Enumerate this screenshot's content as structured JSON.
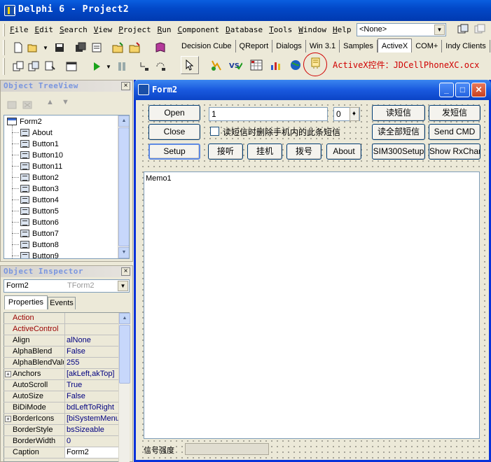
{
  "ide": {
    "title": "Delphi 6 - Project2",
    "menu": [
      "File",
      "Edit",
      "Search",
      "View",
      "Project",
      "Run",
      "Component",
      "Database",
      "Tools",
      "Window",
      "Help"
    ],
    "config_combo": "<None>",
    "palette_tabs": [
      "Decision Cube",
      "QReport",
      "Dialogs",
      "Win 3.1",
      "Samples",
      "ActiveX",
      "COM+",
      "Indy Clients"
    ],
    "active_tab": "ActiveX",
    "activex_note": "ActiveX控件：JDCellPhoneXC.ocx"
  },
  "tree_view": {
    "title": "Object TreeView",
    "root": "Form2",
    "items": [
      "About",
      "Button1",
      "Button10",
      "Button11",
      "Button2",
      "Button3",
      "Button4",
      "Button5",
      "Button6",
      "Button7",
      "Button8",
      "Button9"
    ]
  },
  "inspector": {
    "title": "Object Inspector",
    "object_name": "Form2",
    "object_type": "TForm2",
    "tabs": [
      "Properties",
      "Events"
    ],
    "rows": [
      {
        "name": "Action",
        "value": "",
        "red": true
      },
      {
        "name": "ActiveControl",
        "value": "",
        "red": true
      },
      {
        "name": "Align",
        "value": "alNone"
      },
      {
        "name": "AlphaBlend",
        "value": "False"
      },
      {
        "name": "AlphaBlendValue",
        "value": "255"
      },
      {
        "name": "Anchors",
        "value": "[akLeft,akTop]",
        "expand": true
      },
      {
        "name": "AutoScroll",
        "value": "True"
      },
      {
        "name": "AutoSize",
        "value": "False"
      },
      {
        "name": "BiDiMode",
        "value": "bdLeftToRight"
      },
      {
        "name": "BorderIcons",
        "value": "[biSystemMenu,",
        "expand": true
      },
      {
        "name": "BorderStyle",
        "value": "bsSizeable"
      },
      {
        "name": "BorderWidth",
        "value": "0"
      },
      {
        "name": "Caption",
        "value": "Form2",
        "selected": true
      }
    ]
  },
  "form": {
    "title": "Form2",
    "buttons": {
      "open": "Open",
      "close": "Close",
      "setup": "Setup",
      "answer": "接听",
      "hangup": "挂机",
      "dial": "拨号",
      "about": "About",
      "read_sms": "读短信",
      "send_sms": "发短信",
      "read_all_sms": "读全部短信",
      "send_cmd": "Send CMD",
      "sim300_setup": "SIM300Setup",
      "show_rxchar": "Show RxChar"
    },
    "edit_value": "1",
    "spin_value": "0",
    "delete_checkbox_label": "读短信时删除手机内的此条短信",
    "memo_text": "Memo1",
    "signal_label": "信号强度"
  }
}
